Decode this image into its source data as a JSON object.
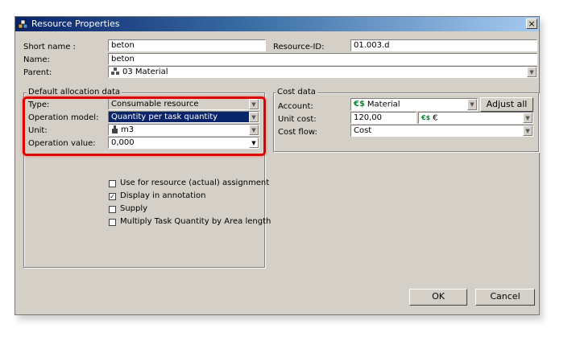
{
  "window": {
    "title": "Resource Properties",
    "close_glyph": "×",
    "icon": "resource-app-icon"
  },
  "fields": {
    "short_name": {
      "label": "Short name :",
      "value": "beton"
    },
    "resource_id": {
      "label": "Resource-ID:",
      "value": "01.003.d"
    },
    "name": {
      "label": "Name:",
      "value": "beton"
    },
    "parent": {
      "label": "Parent:",
      "value": "03 Material",
      "icon": "material-group-icon"
    }
  },
  "default_allocation": {
    "title": "Default allocation data",
    "type": {
      "label": "Type:",
      "value": "Consumable resource"
    },
    "operation_model": {
      "label": "Operation model:",
      "value": "Quantity per task quantity"
    },
    "unit": {
      "label": "Unit:",
      "value": "m3",
      "icon": "unit-icon"
    },
    "operation_value": {
      "label": "Operation value:",
      "value": "0,000"
    },
    "checkboxes": [
      {
        "label": "Use for resource (actual) assignment",
        "checked": false
      },
      {
        "label": "Display in annotation",
        "checked": true
      },
      {
        "label": "Supply",
        "checked": false
      },
      {
        "label": "Multiply Task Quantity by Area length",
        "checked": false
      }
    ]
  },
  "cost_data": {
    "title": "Cost data",
    "account": {
      "label": "Account:",
      "value": "Material",
      "icon": "euro-dollar-icon"
    },
    "adjust_all": "Adjust all",
    "unit_cost": {
      "label": "Unit cost:",
      "value": "120,00",
      "currency": "€",
      "icon": "currency-icon"
    },
    "cost_flow": {
      "label": "Cost flow:",
      "value": "Cost"
    }
  },
  "buttons": {
    "ok": "OK",
    "cancel": "Cancel"
  },
  "colors": {
    "dialog_bg": "#d4d0c8",
    "title_start": "#0a246a",
    "title_end": "#a6caf0",
    "selection": "#0a246a",
    "highlight": "#e00000"
  }
}
